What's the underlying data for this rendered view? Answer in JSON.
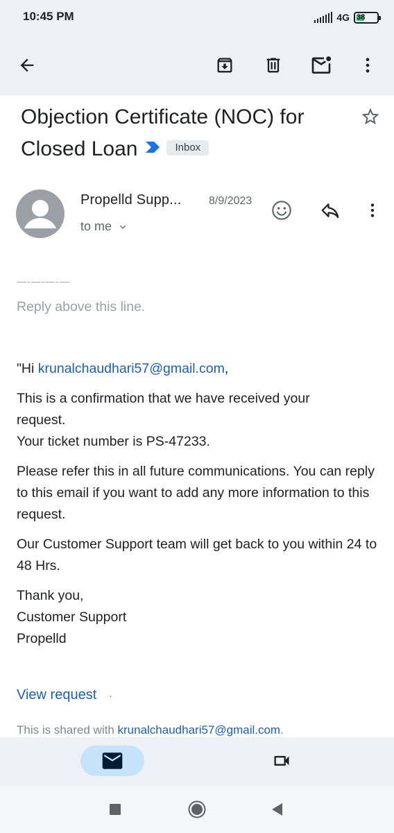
{
  "status_bar": {
    "time": "10:45 PM",
    "network": "4G",
    "battery_level": "38",
    "battery_fraction": 0.38,
    "battery_color": "#33c06a"
  },
  "toolbar": {
    "icons": [
      "back-arrow-icon",
      "archive-icon",
      "delete-icon",
      "mark-unread-icon",
      "more-vert-icon"
    ]
  },
  "email": {
    "subject_line1": "Objection Certificate (NOC) for",
    "subject_line2": "Closed Loan",
    "label": "Inbox",
    "sender": "Propelld Supp...",
    "date": "8/9/2023",
    "recipient": "to me",
    "body": {
      "separator": "—-—-—-—",
      "reply_above": "Reply above this line.",
      "greeting_prefix": "\"Hi ",
      "greeting_email": "krunalchaudhari57@gmail.com",
      "greeting_suffix": ",",
      "p1_line1": "This is a confirmation that we have received your",
      "p1_line2": "request.",
      "p1_line3": "Your ticket number is PS-47233.",
      "p2": "Please refer this in all future communications. You can reply to this email if you want to add any more information to this request.",
      "p3": "Our Customer Support team will get back to you within 24 to 48 Hrs.",
      "sign1": "Thank you,",
      "sign2": "Customer Support",
      "sign3": "Propelld",
      "view_request": "View request",
      "dot": "·",
      "shared_prefix": "This is shared with ",
      "shared_email": "krunalchaudhari57@gmail.com",
      "shared_suffix": "."
    }
  },
  "colors": {
    "link": "#1a5fb4",
    "bar_bg": "#eef1f7",
    "pill": "#c7e2fb",
    "importance": "#1a73e8"
  }
}
